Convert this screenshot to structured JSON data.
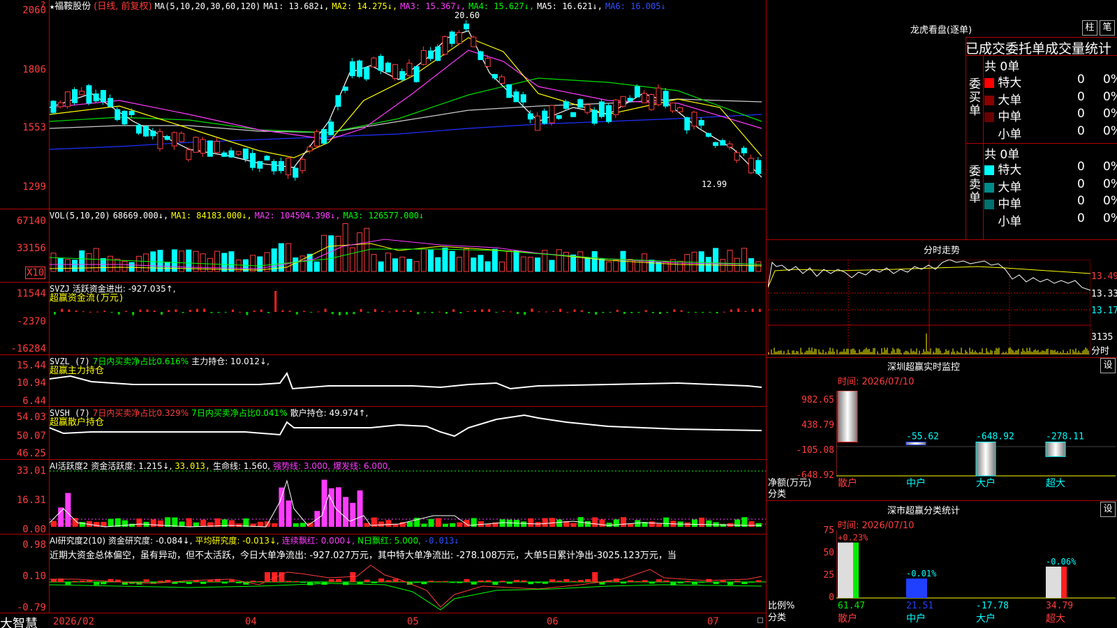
{
  "title_bar": {
    "star": "★",
    "stock_name": "福鞍股份",
    "mode": "(日线, 前复权)",
    "ma_label": "MA(5,10,20,30,60,120)",
    "ma1": "MA1: 13.682↓,",
    "ma2": "MA2: 14.275↓,",
    "ma3": "MA3: 15.367↓,",
    "ma4": "MA4: 15.627↓,",
    "ma5": "MA5: 16.621↓,",
    "ma6": "MA6: 16.005↓",
    "high_mark": "20.60",
    "low_mark": "12.99",
    "corner_mark": "?"
  },
  "price_axis": [
    "2060",
    "1806",
    "1553",
    "1299"
  ],
  "vol": {
    "label": "VOL(5,10,20)",
    "v0": "68669.000↓,",
    "ma1": "MA1: 84183.000↓,",
    "ma2": "MA2: 104504.398↓,",
    "ma3": "MA3: 126577.000↓",
    "axis": [
      "67140",
      "33156"
    ],
    "unit": "X10"
  },
  "svzj": {
    "label": "SVZJ",
    "text": "活跃资金进出: -927.035↑,",
    "sub": "超赢资金流(万元)",
    "axis": [
      "11544",
      "-2370",
      "-16284"
    ]
  },
  "svzl": {
    "label": "SVZL (7)",
    "ratio": "7日内买卖净占比0.616%",
    "hold": "主力持仓: 10.012↓,",
    "sub": "超赢主力持仓",
    "axis": [
      "15.44",
      "10.94",
      "6.44"
    ]
  },
  "svsh": {
    "label": "SVSH (7)",
    "ratio1": "7日内买卖净占比0.329%",
    "ratio2": "7日内买卖净占比0.041%",
    "hold": "散户持仓: 49.974↑,",
    "sub": "超赢散户持仓",
    "axis": [
      "54.03",
      "50.07",
      "46.25"
    ]
  },
  "ai1": {
    "label": "AI活跃度2",
    "t1": "资金活跃度: 1.215↓,",
    "t2": "33.013,",
    "t3": "生命线: 1.560,",
    "t4": "强势线: 3.000,",
    "t5": "爆发线: 6.000,",
    "axis": [
      "33.01",
      "16.31",
      "0.00"
    ]
  },
  "ai2": {
    "label": "AI研究度2(10)",
    "t1": "资金研究度: -0.084↓,",
    "t2": "平均研究度: -0.013↓,",
    "t3": "连续飘红: 0.000↓,",
    "t4": "N日飘红: 5.000,",
    "t5": "-0.013↓",
    "commentary": "近期大资金总体偏空，虽有异动，但不太活跃，今日大单净流出: -927.027万元，其中特大单净流出: -278.108万元，大单5日累计净出-3025.123万元，当",
    "axis": [
      "0.98",
      "0.10",
      "-0.79"
    ]
  },
  "bottom": {
    "brand": "大智慧",
    "dates": [
      "2026/02",
      "04",
      "05",
      "06",
      "07"
    ]
  },
  "lhb": {
    "title": "龙虎看盘(逐单)",
    "btn1": "柱",
    "btn2": "笔",
    "header": "已成交委托单成交量统计",
    "buy_label": "委买单",
    "sell_label": "委卖单",
    "buy_total": "共 0单",
    "sell_total": "共 0单",
    "buy_rows": [
      {
        "name": "特大",
        "qty": "0",
        "pct": "0%",
        "color": "#ff0000"
      },
      {
        "name": "大单",
        "qty": "0",
        "pct": "0%",
        "color": "#8b0000"
      },
      {
        "name": "中单",
        "qty": "0",
        "pct": "0%",
        "color": "#6b0000"
      },
      {
        "name": "小单",
        "qty": "0",
        "pct": "0%",
        "color": "#000000"
      }
    ],
    "sell_rows": [
      {
        "name": "特大",
        "qty": "0",
        "pct": "0%",
        "color": "#00ffff"
      },
      {
        "name": "大单",
        "qty": "0",
        "pct": "0%",
        "color": "#008b8b"
      },
      {
        "name": "中单",
        "qty": "0",
        "pct": "0%",
        "color": "#007070"
      },
      {
        "name": "小单",
        "qty": "0",
        "pct": "0%",
        "color": "#000000"
      }
    ]
  },
  "intraday": {
    "title": "分时走势",
    "axis": [
      "13.49",
      "13.33",
      "13.17"
    ],
    "vol_max": "3135",
    "unit": "分时"
  },
  "sz_monitor": {
    "title": "深圳超赢实时监控",
    "btn": "设",
    "time": "时间: 2026/07/10",
    "axis": [
      "982.65",
      "438.79",
      "-105.08",
      "-648.92"
    ],
    "unit_label": "净额(万元)",
    "cat_label": "分类",
    "categories": [
      "散户",
      "中户",
      "大户",
      "超大"
    ],
    "values": [
      "982.65",
      "-55.62",
      "-648.92",
      "-278.11"
    ]
  },
  "sz_class": {
    "title": "深市超赢分类统计",
    "btn": "设",
    "time": "时间: 2026/07/10",
    "axis": [
      "75",
      "50",
      "25",
      "0"
    ],
    "ratio_label": "比例%",
    "cat_label": "分类",
    "categories": [
      "散户",
      "中户",
      "大户",
      "超大"
    ],
    "top_values": [
      "+0.23%",
      "-0.01%",
      "",
      "-0.06%"
    ],
    "bottom_values": [
      "61.47",
      "21.51",
      "-17.78",
      "34.79"
    ]
  }
}
